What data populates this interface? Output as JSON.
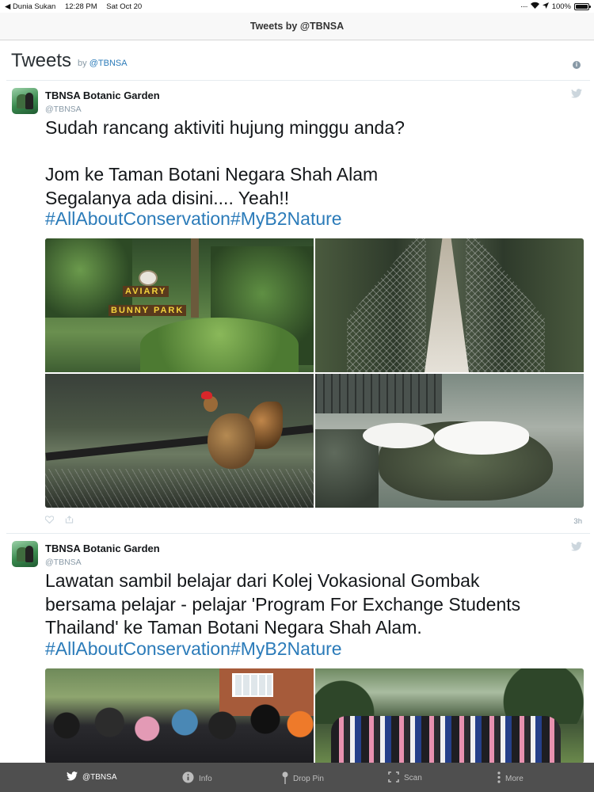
{
  "status_bar": {
    "back_app": "◀ Dunia Sukan",
    "time": "12:28 PM",
    "date": "Sat Oct 20",
    "battery": "100%"
  },
  "nav": {
    "title": "Tweets by @TBNSA"
  },
  "timeline": {
    "title": "Tweets",
    "by_label": "by",
    "handle": "@TBNSA"
  },
  "tweets": [
    {
      "author": "TBNSA Botanic Garden",
      "handle": "@TBNSA",
      "text": "Sudah rancang aktiviti hujung minggu anda?\n\nJom ke Taman Botani Negara Shah Alam\nSegalanya ada disini.... Yeah!!",
      "hashtags": "#AllAboutConservation#MyB2Nature",
      "photos": [
        {
          "sign_top": "AVIARY",
          "sign_bottom": "BUNNY PARK"
        },
        {},
        {},
        {}
      ],
      "time": "3h"
    },
    {
      "author": "TBNSA Botanic Garden",
      "handle": "@TBNSA",
      "text": "Lawatan sambil belajar dari Kolej Vokasional Gombak\nbersama pelajar - pelajar 'Program For Exchange Students\nThailand' ke Taman Botani Negara Shah Alam.",
      "hashtags": "#AllAboutConservation#MyB2Nature"
    }
  ],
  "tabbar": {
    "items": [
      {
        "label": "@TBNSA",
        "icon": "twitter-bird-icon"
      },
      {
        "label": "Info",
        "icon": "info-icon"
      },
      {
        "label": "Drop Pin",
        "icon": "pin-icon"
      },
      {
        "label": "Scan",
        "icon": "scan-icon"
      },
      {
        "label": "More",
        "icon": "more-icon"
      }
    ]
  }
}
